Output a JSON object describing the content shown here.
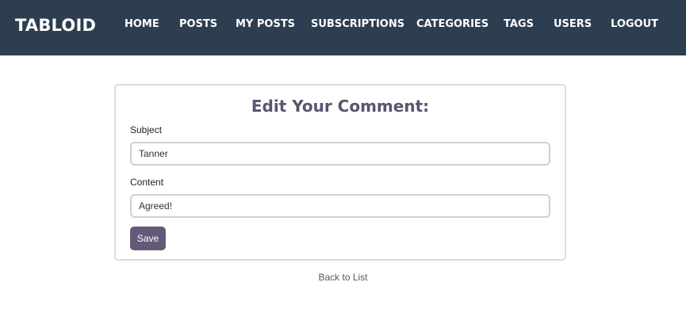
{
  "navbar": {
    "brand": "TABLOID",
    "background_color": "#2c3e50",
    "links": [
      {
        "label": "HOME"
      },
      {
        "label": "POSTS"
      },
      {
        "label": "MY POSTS"
      },
      {
        "label": "SUBSCRIPTIONS"
      },
      {
        "label": "CATEGORIES"
      },
      {
        "label": "TAGS"
      },
      {
        "label": "USERS"
      },
      {
        "label": "LOGOUT"
      }
    ]
  },
  "form": {
    "title": "Edit Your Comment:",
    "subject": {
      "label": "Subject",
      "value": "Tanner"
    },
    "content": {
      "label": "Content",
      "value": "Agreed!"
    },
    "save_label": "Save",
    "accent_color": "#645a78"
  },
  "back_link": "Back to List"
}
